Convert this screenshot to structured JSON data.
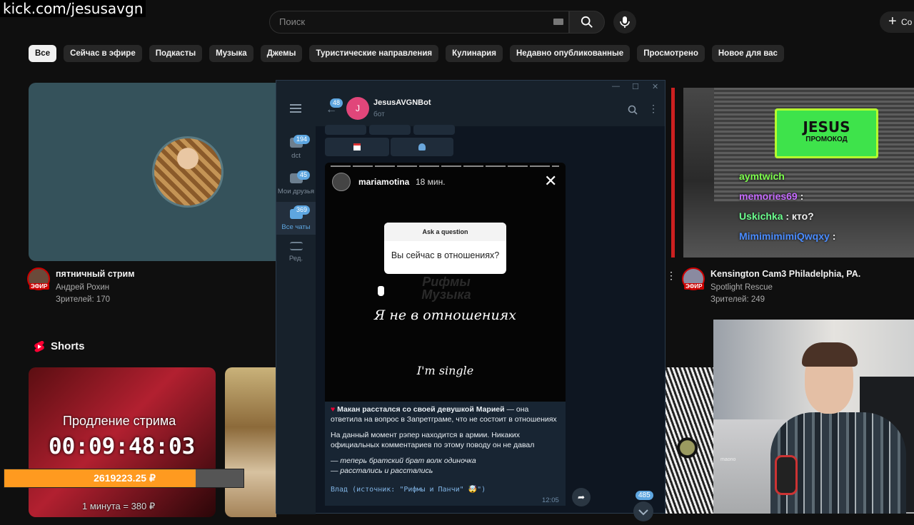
{
  "overlay": {
    "kick_url": "kick.com/jesusavgn"
  },
  "search": {
    "placeholder": "Поиск"
  },
  "header": {
    "create_label": "Со"
  },
  "chips": [
    "Все",
    "Сейчас в эфире",
    "Подкасты",
    "Музыка",
    "Джемы",
    "Туристические направления",
    "Кулинария",
    "Недавно опубликованные",
    "Просмотрено",
    "Новое для вас"
  ],
  "videos": {
    "v1": {
      "title": "пятничный стрим",
      "channel": "Андрей Рохин",
      "viewers": "Зрителей: 170",
      "badge": "ЭФИР"
    },
    "v3": {
      "title": "Kensington Cam3  Philadelphia, PA.",
      "channel": "Spotlight Rescue",
      "viewers": "Зрителей: 249",
      "badge": "ЭФИР"
    }
  },
  "shorts": {
    "title": "Shorts",
    "overlay_label": "Продление стрима",
    "timer": "00:09:48:03",
    "donation_amount": "2619223.25 ₽",
    "donation_rate": "1 минута = 380 ₽",
    "donation_progress": 0.8
  },
  "card3_overlay": {
    "jesus_title": "JESUS",
    "jesus_sub": "ПРОМОКОД",
    "chat": [
      {
        "user": "aymtwich",
        "text": "",
        "color": "#7dff4d"
      },
      {
        "user": "memories69",
        "text": ":",
        "color": "#c66bff"
      },
      {
        "user": "Uskichka",
        "text": ": кто?",
        "color": "#6bff8e"
      },
      {
        "user": "MimimimimiQwqxy",
        "text": ":",
        "color": "#4a8cff"
      }
    ]
  },
  "telegram": {
    "sidebar": [
      {
        "label": "dct",
        "badge": "194"
      },
      {
        "label": "Мои друзья",
        "badge": "45"
      },
      {
        "label": "Все чаты",
        "badge": "369"
      },
      {
        "label": "Ред.",
        "badge": ""
      }
    ],
    "header": {
      "name": "JesusAVGNBot",
      "status": "бот",
      "back_badge": "48",
      "avatar_letter": "J"
    },
    "story": {
      "user": "mariamotina",
      "time": "18 мин.",
      "question_header": "Ask a question",
      "question": "Вы сейчас в отношениях?",
      "watermark": "Рифмы Музыка",
      "answer_ru": "Я не в отношениях",
      "answer_en": "I'm single"
    },
    "message": {
      "headline": "Макан расстался со своей девушкой Марией",
      "line1": " — она ответила на вопрос в Запретграме, что не состоит в отношениях",
      "para2": "На данный момент рэпер находится в армии. Никаких официальных комментариев по этому поводу он не давал",
      "quote1": "— теперь братский брат волк одиночка",
      "quote2": "— расстались и расстались",
      "footer": "Влад (источник: \"Рифмы и Панчи\" 🤯\")",
      "time": "12:05"
    },
    "scroll_badge": "485"
  },
  "webcam": {
    "mic_label": "maono"
  }
}
